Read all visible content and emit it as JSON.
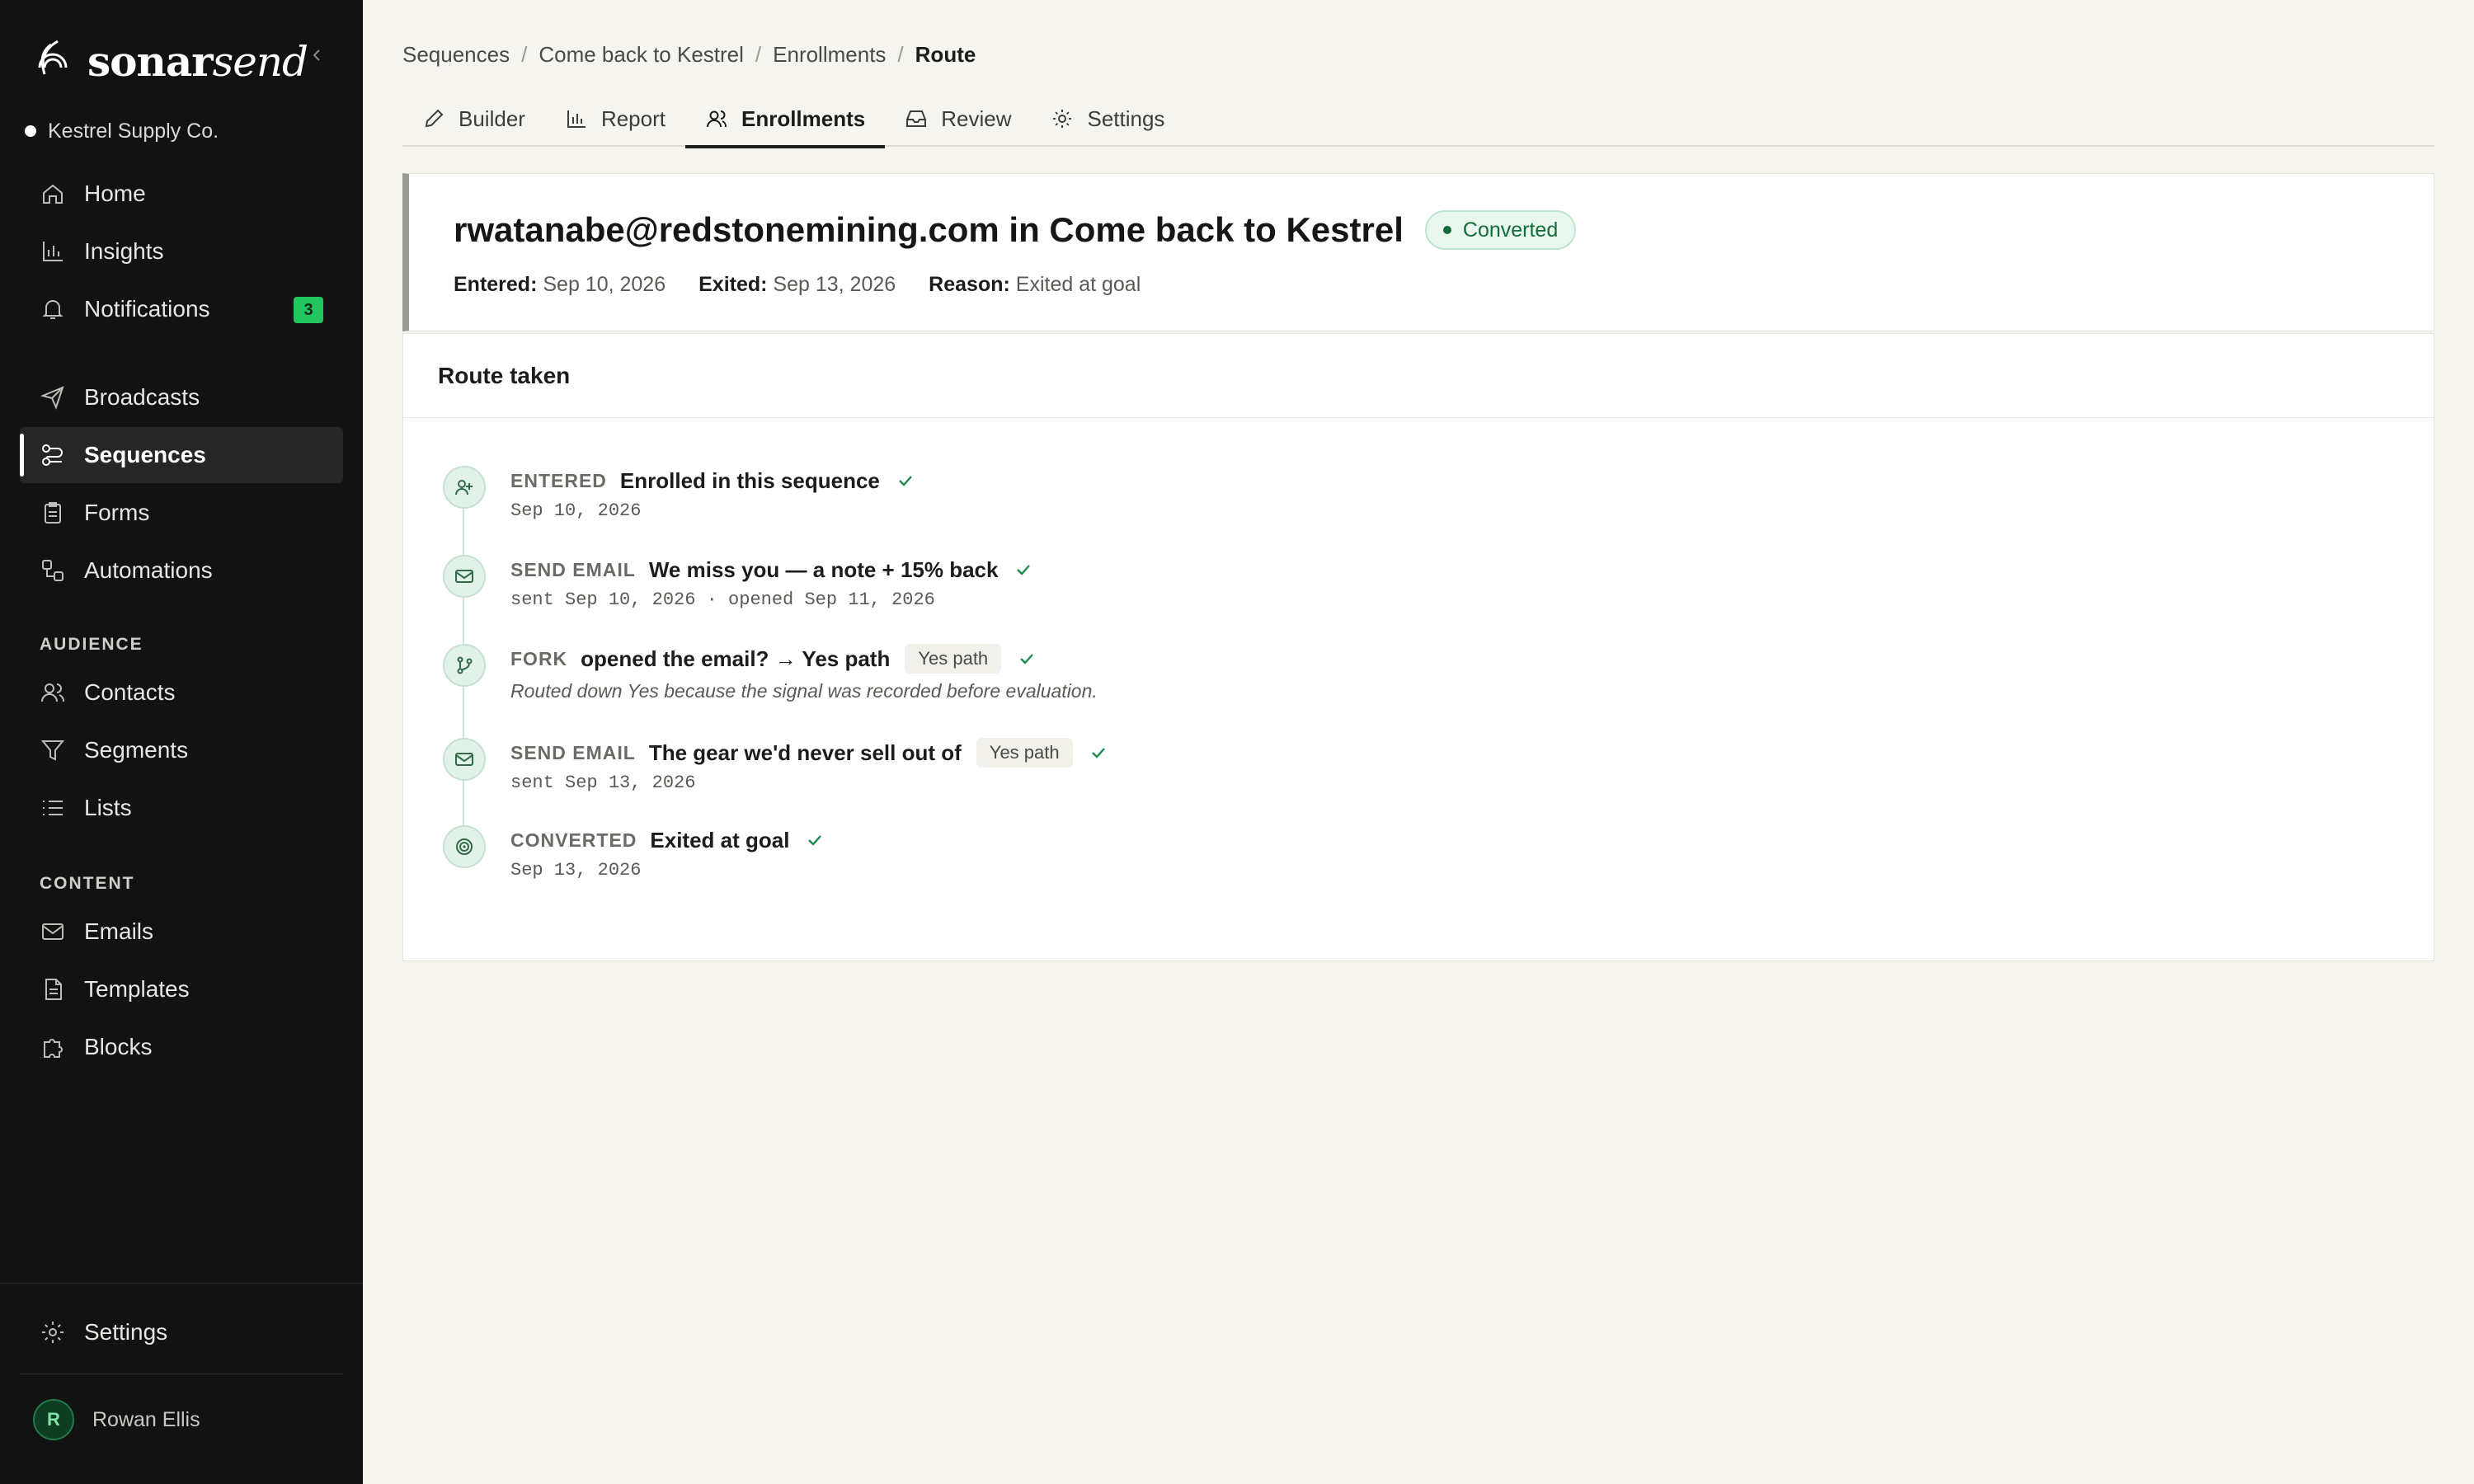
{
  "brand": {
    "name_bold": "sonar",
    "name_italic": "send"
  },
  "workspace": {
    "name": "Kestrel Supply Co."
  },
  "nav": {
    "home": "Home",
    "insights": "Insights",
    "notifications": "Notifications",
    "notifications_badge": "3",
    "broadcasts": "Broadcasts",
    "sequences": "Sequences",
    "forms": "Forms",
    "automations": "Automations",
    "audience_label": "AUDIENCE",
    "contacts": "Contacts",
    "segments": "Segments",
    "lists": "Lists",
    "content_label": "CONTENT",
    "emails": "Emails",
    "templates": "Templates",
    "blocks": "Blocks",
    "settings": "Settings"
  },
  "user": {
    "initial": "R",
    "name": "Rowan Ellis"
  },
  "breadcrumb": [
    "Sequences",
    "Come back to Kestrel",
    "Enrollments",
    "Route"
  ],
  "tabs": [
    "Builder",
    "Report",
    "Enrollments",
    "Review",
    "Settings"
  ],
  "enrollment": {
    "title": "rwatanabe@redstonemining.com in Come back to Kestrel",
    "status": "Converted",
    "entered_label": "Entered:",
    "entered": "Sep 10, 2026",
    "exited_label": "Exited:",
    "exited": "Sep 13, 2026",
    "reason_label": "Reason:",
    "reason": "Exited at goal"
  },
  "route": {
    "heading": "Route taken",
    "steps": [
      {
        "kind": "ENTERED",
        "title": "Enrolled in this sequence",
        "sub": "Sep 10, 2026",
        "icon": "user-plus-icon"
      },
      {
        "kind": "SEND EMAIL",
        "title": "We miss you — a note + 15% back",
        "sub": "sent Sep 10, 2026 · opened Sep 11, 2026",
        "icon": "mail-icon"
      },
      {
        "kind": "FORK",
        "title": "opened the email? → Yes path",
        "pill": "Yes path",
        "note": "Routed down Yes because the signal was recorded before evaluation.",
        "icon": "branch-icon"
      },
      {
        "kind": "SEND EMAIL",
        "title": "The gear we'd never sell out of",
        "pill": "Yes path",
        "sub": "sent Sep 13, 2026",
        "icon": "mail-icon"
      },
      {
        "kind": "CONVERTED",
        "title": "Exited at goal",
        "sub": "Sep 13, 2026",
        "icon": "target-icon"
      }
    ]
  },
  "colors": {
    "accent_green": "#22c55e",
    "sidebar_bg": "#121212",
    "converted_text": "#146c3b"
  }
}
